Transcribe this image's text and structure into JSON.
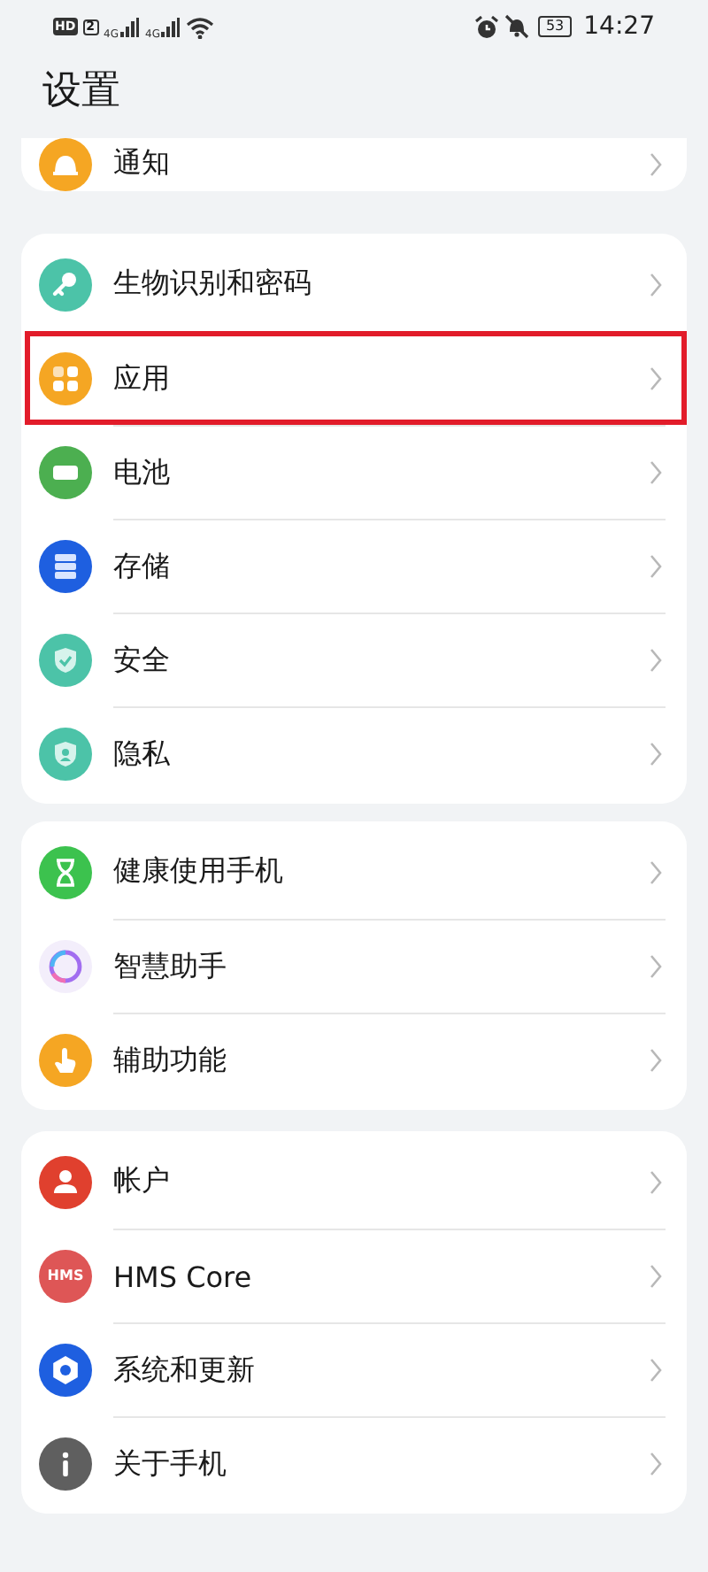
{
  "status_bar": {
    "hd": "HD",
    "sim": "2",
    "network_1": "4G",
    "network_2": "4G",
    "battery": "53",
    "time": "14:27"
  },
  "title": "设置",
  "groups": [
    {
      "items": [
        {
          "label": "通知",
          "color": "#f5a623",
          "highlighted": false
        }
      ]
    },
    {
      "items": [
        {
          "label": "生物识别和密码",
          "color": "#4cc3a8",
          "highlighted": false
        },
        {
          "label": "应用",
          "color": "#f5a623",
          "highlighted": true
        },
        {
          "label": "电池",
          "color": "#4caf50",
          "highlighted": false
        },
        {
          "label": "存储",
          "color": "#1e5fe0",
          "highlighted": false
        },
        {
          "label": "安全",
          "color": "#4cc3a8",
          "highlighted": false
        },
        {
          "label": "隐私",
          "color": "#4cc3a8",
          "highlighted": false
        }
      ]
    },
    {
      "items": [
        {
          "label": "健康使用手机",
          "color": "#3cc24e",
          "highlighted": false
        },
        {
          "label": "智慧助手",
          "color": "#f3eefb",
          "highlighted": false
        },
        {
          "label": "辅助功能",
          "color": "#f5a623",
          "highlighted": false
        }
      ]
    },
    {
      "items": [
        {
          "label": "帐户",
          "color": "#e0402e",
          "highlighted": false
        },
        {
          "label": "HMS Core",
          "color": "#de5656",
          "highlighted": false,
          "icon_text": "HMS"
        },
        {
          "label": "系统和更新",
          "color": "#1e5fe0",
          "highlighted": false
        },
        {
          "label": "关于手机",
          "color": "#5f5f5f",
          "highlighted": false
        }
      ]
    }
  ]
}
